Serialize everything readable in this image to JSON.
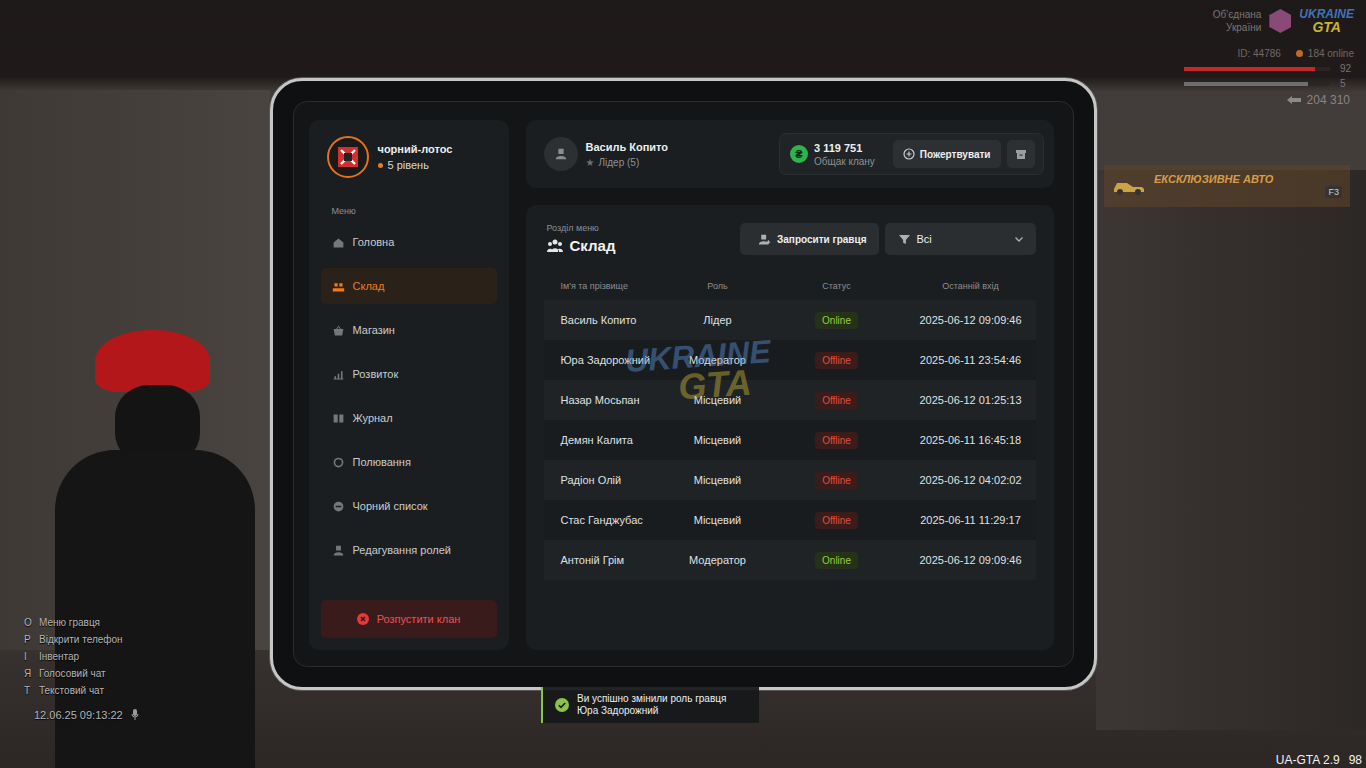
{
  "hud": {
    "server_name": "Об'єднана України",
    "logo": [
      "UKRAINE",
      "GTA"
    ],
    "player_id": "ID: 44786",
    "online": "184 online",
    "bars": [
      {
        "value": "92",
        "level": 0.9,
        "color": "#c62828"
      },
      {
        "value": "5",
        "level": 0.85,
        "color": "#6e6e6e"
      }
    ],
    "money": "204 310"
  },
  "promo": {
    "title": "ЕКСКЛЮЗИВНЕ АВТО",
    "key": "F3"
  },
  "hotkeys": [
    {
      "key": "O",
      "label": "Меню гравця"
    },
    {
      "key": "P",
      "label": "Відкрити телефон"
    },
    {
      "key": "I",
      "label": "Інвентар"
    },
    {
      "key": "Я",
      "label": "Голосовий чат"
    },
    {
      "key": "T",
      "label": "Текстовий чат"
    }
  ],
  "clock": "12.06.25 09:13:22",
  "version": "UA-GTA 2.9",
  "fps": "98",
  "tablet": {
    "clan": {
      "name": "чорний-лотос",
      "level": "5 рівень"
    },
    "menu_label": "Меню",
    "menu": [
      {
        "label": "Головна",
        "selected": false
      },
      {
        "label": "Склад",
        "selected": true
      },
      {
        "label": "Магазин",
        "selected": false
      },
      {
        "label": "Розвиток",
        "selected": false
      },
      {
        "label": "Журнал",
        "selected": false
      },
      {
        "label": "Полювання",
        "selected": false
      },
      {
        "label": "Чорний список",
        "selected": false
      },
      {
        "label": "Редагування ролей",
        "selected": false
      }
    ],
    "dismiss": "Розпустити клан",
    "user": {
      "name": "Василь Копито",
      "role_icon": "★",
      "role": "Лідер (5)"
    },
    "treasury": {
      "currency": "₴",
      "amount": "3 119 751",
      "label": "Общак клану",
      "donate": "Пожертвувати"
    },
    "section": {
      "caption": "Розділ меню",
      "title": "Склад"
    },
    "invite": "Запросити гравця",
    "filter": {
      "value": "Всі"
    },
    "table": {
      "columns": [
        "Ім'я та прізвище",
        "Роль",
        "Статус",
        "Останній вхід"
      ],
      "rows": [
        {
          "name": "Василь Копито",
          "role": "Лідер",
          "status": "Online",
          "online": true,
          "last_login": "2025-06-12 09:09:46"
        },
        {
          "name": "Юра Задорожний",
          "role": "Модератор",
          "status": "Offline",
          "online": false,
          "last_login": "2025-06-11 23:54:46"
        },
        {
          "name": "Назар Мосьпан",
          "role": "Місцевий",
          "status": "Offline",
          "online": false,
          "last_login": "2025-06-12 01:25:13"
        },
        {
          "name": "Демян Калита",
          "role": "Місцевий",
          "status": "Offline",
          "online": false,
          "last_login": "2025-06-11 16:45:18"
        },
        {
          "name": "Радіон Олій",
          "role": "Місцевий",
          "status": "Offline",
          "online": false,
          "last_login": "2025-06-12 04:02:02"
        },
        {
          "name": "Стас Ганджубас",
          "role": "Місцевий",
          "status": "Offline",
          "online": false,
          "last_login": "2025-06-11 11:29:17"
        },
        {
          "name": "Антоній Грім",
          "role": "Модератор",
          "status": "Online",
          "online": true,
          "last_login": "2025-06-12 09:09:46"
        }
      ]
    },
    "watermark": [
      "UKRAINE",
      "GTA"
    ]
  },
  "notification": {
    "text": "Ви успішно змінили роль гравця Юра Задорожний"
  }
}
